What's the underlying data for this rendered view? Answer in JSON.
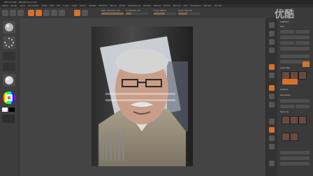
{
  "window": {
    "title": "ZBrush 4R6 - ZBrushDocument"
  },
  "menu": {
    "items": [
      "Alpha",
      "Brush",
      "Color",
      "Document",
      "Draw",
      "Edit",
      "File",
      "Layer",
      "Light",
      "Macro",
      "Marker",
      "Material",
      "Movie",
      "Picker",
      "Preferences",
      "Render",
      "Stencil",
      "Stroke",
      "Texture",
      "Tool",
      "Transform",
      "Zplugin",
      "Zscript"
    ]
  },
  "toolbar": {
    "focal_label": "Focal Shift 0",
    "draw_label": "Draw Size 64",
    "intensity_label": "Z Intensity 25",
    "rgb_label": "Rgb Intensity 100"
  },
  "right": {
    "panel_title": "Lightbox",
    "tool_title": "Tool",
    "section_1": "Load Tool",
    "section_2": "Save As",
    "section_3": "Subtool",
    "section_4": "Geometry"
  },
  "watermark": "优酷"
}
